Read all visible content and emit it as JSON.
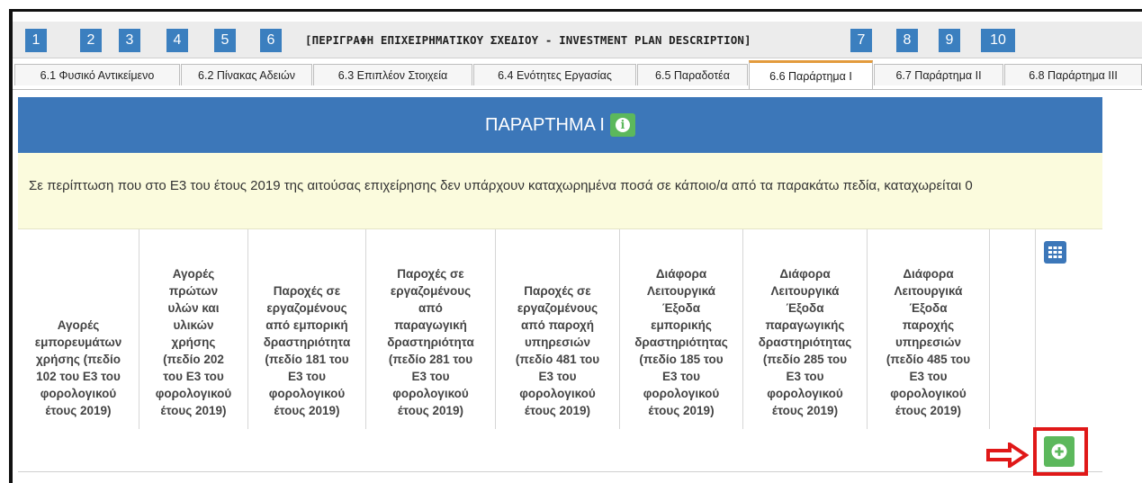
{
  "steps": {
    "numbers": [
      "1",
      "2",
      "3",
      "4",
      "5",
      "6",
      "7",
      "8",
      "9",
      "10"
    ],
    "active_title": "[ΠΕΡΙΓΡΑΦΗ ΕΠΙΧΕΙΡΗΜΑΤΙΚΟΥ ΣΧΕΔΙΟΥ - INVESTMENT PLAN DESCRIPTION]"
  },
  "tabs": [
    {
      "label": "6.1 Φυσικό Αντικείμενο",
      "active": false
    },
    {
      "label": "6.2 Πίνακας Αδειών",
      "active": false
    },
    {
      "label": "6.3 Επιπλέον Στοιχεία",
      "active": false
    },
    {
      "label": "6.4 Ενότητες Εργασίας",
      "active": false
    },
    {
      "label": "6.5 Παραδοτέα",
      "active": false
    },
    {
      "label": "6.6 Παράρτημα Ι",
      "active": true
    },
    {
      "label": "6.7 Παράρτημα ΙΙ",
      "active": false
    },
    {
      "label": "6.8 Παράρτημα ΙΙΙ",
      "active": false
    }
  ],
  "panel": {
    "title": "ΠΑΡΑΡΤΗΜΑ Ι",
    "info_icon": "info-circle-icon",
    "notice": "Σε περίπτωση που στο Ε3 του έτους 2019 της αιτούσας επιχείρησης δεν υπάρχουν καταχωρημένα ποσά σε κάποιο/α από τα παρακάτω πεδία, καταχωρείται 0"
  },
  "table": {
    "columns": [
      "Αγορές εμπορευμάτων χρήσης (πεδίο 102 του Ε3 του φορολογικού έτους 2019)",
      "Αγορές πρώτων υλών και υλικών χρήσης (πεδίο 202 του Ε3 του φορολογικού έτους 2019)",
      "Παροχές σε εργαζομένους από εμπορική δραστηριότητα (πεδίο 181 του Ε3 του φορολογικού έτους 2019)",
      "Παροχές σε εργαζομένους από παραγωγική δραστηριότητα (πεδίο 281 του Ε3 του φορολογικού έτους 2019)",
      "Παροχές σε εργαζομένους από παροχή υπηρεσιών (πεδίο 481 του Ε3 του φορολογικού έτους 2019)",
      "Διάφορα Λειτουργικά Έξοδα εμπορικής δραστηριότητας (πεδίο 185 του Ε3 του φορολογικού έτους 2019)",
      "Διάφορα Λειτουργικά Έξοδα παραγωγικής δραστηριότητας (πεδίο 285 του Ε3 του φορολογικού έτους 2019)",
      "Διάφορα Λειτουργικά Έξοδα παροχής υπηρεσιών (πεδίο 485 του Ε3 του φορολογικού έτους 2019)"
    ],
    "column_lines": [
      [
        "Αγορές",
        "εμπορευμάτων",
        "χρήσης (πεδίο",
        "102 του Ε3 του",
        "φορολογικού",
        "έτους 2019)"
      ],
      [
        "Αγορές",
        "πρώτων",
        "υλών και",
        "υλικών",
        "χρήσης",
        "(πεδίο 202",
        "του Ε3 του",
        "φορολογικού",
        "έτους 2019)"
      ],
      [
        "Παροχές σε",
        "εργαζομένους",
        "από εμπορική",
        "δραστηριότητα",
        "(πεδίο 181 του",
        "Ε3 του",
        "φορολογικού",
        "έτους 2019)"
      ],
      [
        "Παροχές σε",
        "εργαζομένους",
        "από",
        "παραγωγική",
        "δραστηριότητα",
        "(πεδίο 281 του",
        "Ε3 του",
        "φορολογικού",
        "έτους 2019)"
      ],
      [
        "Παροχές σε",
        "εργαζομένους",
        "από παροχή",
        "υπηρεσιών",
        "(πεδίο 481 του",
        "Ε3 του",
        "φορολογικού",
        "έτους 2019)"
      ],
      [
        "Διάφορα",
        "Λειτουργικά",
        "Έξοδα",
        "εμπορικής",
        "δραστηριότητας",
        "(πεδίο 185 του",
        "Ε3 του",
        "φορολογικού",
        "έτους 2019)"
      ],
      [
        "Διάφορα",
        "Λειτουργικά",
        "Έξοδα",
        "παραγωγικής",
        "δραστηριότητας",
        "(πεδίο 285 του",
        "Ε3 του",
        "φορολογικού",
        "έτους 2019)"
      ],
      [
        "Διάφορα",
        "Λειτουργικά",
        "Έξοδα",
        "παροχής",
        "υπηρεσιών",
        "(πεδίο 485 του",
        "Ε3 του",
        "φορολογικού",
        "έτους 2019)"
      ]
    ],
    "column_chooser_icon": "grid-icon",
    "add_row_icon": "plus-circle-icon"
  },
  "colors": {
    "step_blue": "#3b7fbf",
    "header_blue": "#3c77b9",
    "notice_bg": "#fbfbdd",
    "success_green": "#5cb85c",
    "highlight_red": "#e01818",
    "active_tab_accent": "#e39b3d"
  }
}
